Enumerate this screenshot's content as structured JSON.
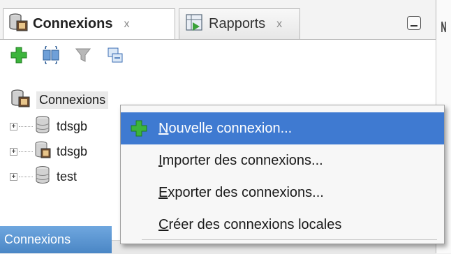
{
  "tabs": [
    {
      "label": "Connexions",
      "close": "x",
      "active": true,
      "icon": "database-connections-icon"
    },
    {
      "label": "Rapports",
      "close": "x",
      "active": false,
      "icon": "reports-icon"
    }
  ],
  "toolbar": {
    "buttons": [
      {
        "icon": "add-connection-icon"
      },
      {
        "icon": "refresh-icon"
      },
      {
        "icon": "filter-icon"
      },
      {
        "icon": "collapse-all-icon"
      }
    ]
  },
  "tree": {
    "root_label": "Connexions",
    "nodes": [
      {
        "label": "tdsgb",
        "icon": "database-icon"
      },
      {
        "label": "tdsgb",
        "icon": "database-connected-icon"
      },
      {
        "label": "test",
        "icon": "database-icon"
      }
    ]
  },
  "menu": {
    "items": [
      {
        "mnemonic": "N",
        "rest": "ouvelle connexion...",
        "icon": "add-icon",
        "selected": true
      },
      {
        "mnemonic": "I",
        "rest": "mporter des connexions...",
        "icon": "",
        "selected": false
      },
      {
        "mnemonic": "E",
        "rest": "xporter des connexions...",
        "icon": "",
        "selected": false
      },
      {
        "mnemonic": "C",
        "rest": "réer des connexions locales",
        "icon": "",
        "selected": false
      }
    ]
  },
  "status_tab": "Connexions",
  "colors": {
    "selection": "#3f7ad1",
    "status_tab": "#4a86c5"
  }
}
